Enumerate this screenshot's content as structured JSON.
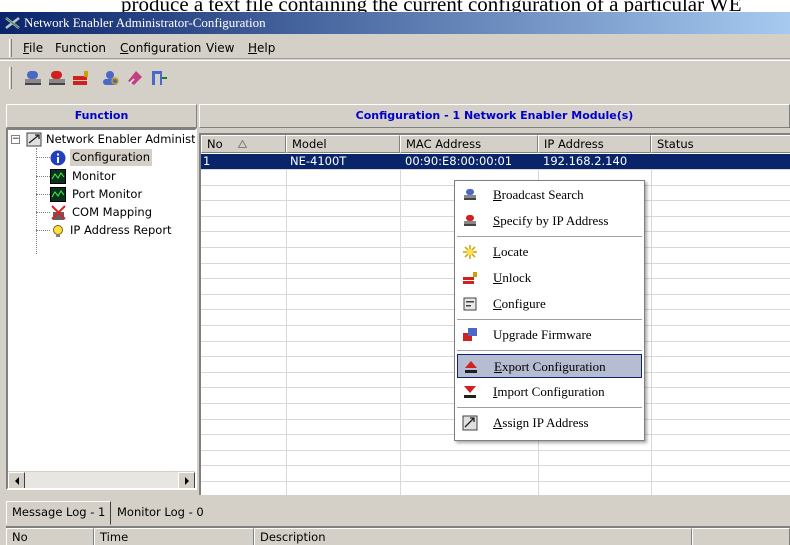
{
  "document_text": "produce a text file containing the current configuration of a particular WE",
  "window": {
    "title": "Network Enabler Administrator-Configuration"
  },
  "menu": [
    "File",
    "Function",
    "Configuration",
    "View",
    "Help"
  ],
  "toolbar": [
    "broadcast-search-icon",
    "specify-ip-icon",
    "unlock-icon",
    "search-user-icon",
    "configure-icon",
    "exit-icon"
  ],
  "function_panel": {
    "title": "Function",
    "root": "Network Enabler Administrator",
    "items": [
      "Configuration",
      "Monitor",
      "Port Monitor",
      "COM Mapping",
      "IP Address Report"
    ]
  },
  "config_panel": {
    "title": "Configuration - 1 Network Enabler Module(s)",
    "columns": [
      "No",
      "Model",
      "MAC Address",
      "IP Address",
      "Status"
    ],
    "rows": [
      {
        "no": "1",
        "model": "NE-4100T",
        "mac": "00:90:E8:00:00:01",
        "ip": "192.168.2.140",
        "status": ""
      }
    ]
  },
  "context_menu": [
    {
      "label": "Broadcast Search",
      "accel": "B"
    },
    {
      "label": "Specify by IP Address",
      "accel": "S"
    },
    {
      "label": "Locate",
      "accel": "L"
    },
    {
      "label": "Unlock",
      "accel": "U"
    },
    {
      "label": "Configure",
      "accel": "C"
    },
    {
      "label": "Upgrade Firmware",
      "accel": ""
    },
    {
      "label": "Export Configuration",
      "accel": "E"
    },
    {
      "label": "Import Configuration",
      "accel": "I"
    },
    {
      "label": "Assign IP Address",
      "accel": "A"
    }
  ],
  "bottom_tabs": [
    "Message Log - 1",
    "Monitor Log - 0"
  ],
  "log_columns": [
    "No",
    "Time",
    "Description"
  ],
  "colors": {
    "selection": "#0a246a",
    "panel_title": "#0000cc",
    "menu_hover": "#b6bdd2"
  }
}
